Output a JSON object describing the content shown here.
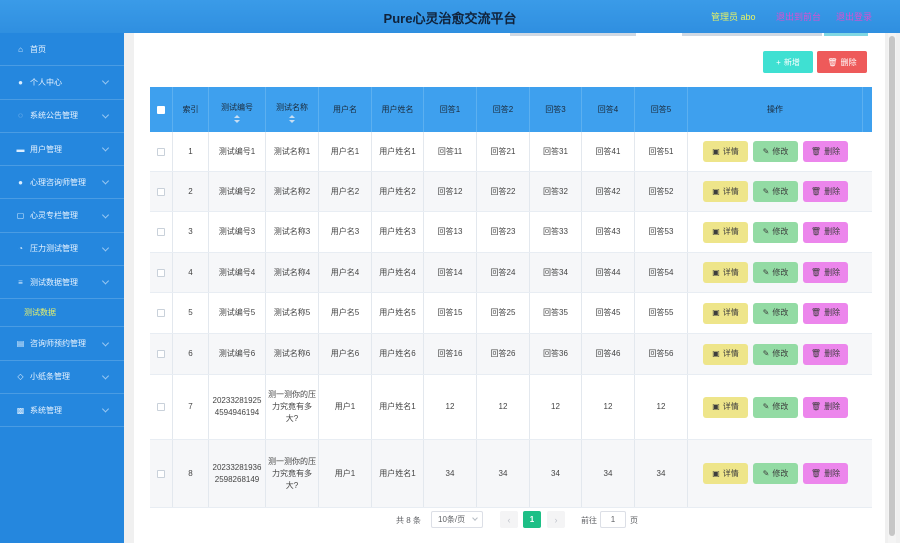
{
  "header": {
    "title": "Pure心灵治愈交流平台",
    "admin": "管理员 abo",
    "exit_front": "退出到前台",
    "logout": "退出登录"
  },
  "sidebar": {
    "items": [
      {
        "label": "首页",
        "icon": "home-icon",
        "glyph": "⌂"
      },
      {
        "label": "个人中心",
        "icon": "user-icon",
        "glyph": "●"
      },
      {
        "label": "系统公告管理",
        "icon": "bell-icon",
        "glyph": "◌"
      },
      {
        "label": "用户管理",
        "icon": "folder-icon",
        "glyph": "▬"
      },
      {
        "label": "心理咨询师管理",
        "icon": "person-icon",
        "glyph": "●"
      },
      {
        "label": "心灵专栏管理",
        "icon": "column-icon",
        "glyph": "▢"
      },
      {
        "label": "压力测试管理",
        "icon": "gauge-icon",
        "glyph": "◔"
      },
      {
        "label": "测试数据管理",
        "icon": "list-icon",
        "glyph": "≡"
      },
      {
        "label": "咨询师预约管理",
        "icon": "calendar-icon",
        "glyph": "▤"
      },
      {
        "label": "小纸条管理",
        "icon": "note-icon",
        "glyph": "◇"
      },
      {
        "label": "系统管理",
        "icon": "settings-icon",
        "glyph": "▩"
      }
    ],
    "submenu_active": "测试数据"
  },
  "toolbar": {
    "add_label": "新增",
    "delete_label": "删除"
  },
  "table": {
    "headers": [
      "索引",
      "测试编号",
      "测试名称",
      "用户名",
      "用户姓名",
      "回答1",
      "回答2",
      "回答3",
      "回答4",
      "回答5",
      "操作"
    ],
    "rows": [
      [
        "1",
        "测试编号1",
        "测试名称1",
        "用户名1",
        "用户姓名1",
        "回答11",
        "回答21",
        "回答31",
        "回答41",
        "回答51"
      ],
      [
        "2",
        "测试编号2",
        "测试名称2",
        "用户名2",
        "用户姓名2",
        "回答12",
        "回答22",
        "回答32",
        "回答42",
        "回答52"
      ],
      [
        "3",
        "测试编号3",
        "测试名称3",
        "用户名3",
        "用户姓名3",
        "回答13",
        "回答23",
        "回答33",
        "回答43",
        "回答53"
      ],
      [
        "4",
        "测试编号4",
        "测试名称4",
        "用户名4",
        "用户姓名4",
        "回答14",
        "回答24",
        "回答34",
        "回答44",
        "回答54"
      ],
      [
        "5",
        "测试编号5",
        "测试名称5",
        "用户名5",
        "用户姓名5",
        "回答15",
        "回答25",
        "回答35",
        "回答45",
        "回答55"
      ],
      [
        "6",
        "测试编号6",
        "测试名称6",
        "用户名6",
        "用户姓名6",
        "回答16",
        "回答26",
        "回答36",
        "回答46",
        "回答56"
      ],
      [
        "7",
        "202332819254594946194",
        "测一测你的压力究竟有多大?",
        "用户1",
        "用户姓名1",
        "12",
        "12",
        "12",
        "12",
        "12"
      ],
      [
        "8",
        "202332819362598268149",
        "测一测你的压力究竟有多大?",
        "用户1",
        "用户姓名1",
        "34",
        "34",
        "34",
        "34",
        "34"
      ]
    ],
    "op_detail": "详情",
    "op_edit": "修改",
    "op_delete": "删除"
  },
  "pagination": {
    "total": "共 8 条",
    "page_size": "10条/页",
    "current_page": "1",
    "goto_label": "前往",
    "goto_value": "1",
    "page_unit": "页"
  }
}
